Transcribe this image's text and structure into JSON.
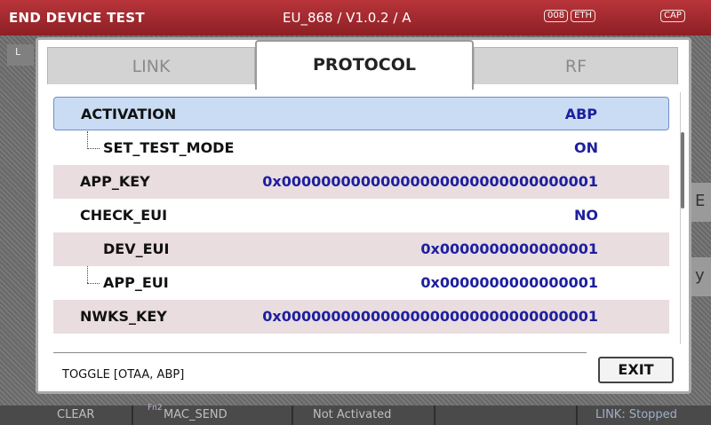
{
  "header": {
    "title": "END DEVICE TEST",
    "version": "EU_868 / V1.0.2 / A",
    "badges": [
      "008",
      "ETH"
    ],
    "badge_right": "CAP"
  },
  "side": {
    "left_tab": "L",
    "right_1": "E",
    "right_2": "y"
  },
  "dialog": {
    "tabs": [
      {
        "label": "LINK",
        "active": false
      },
      {
        "label": "PROTOCOL",
        "active": true
      },
      {
        "label": "RF",
        "active": false
      }
    ],
    "rows": [
      {
        "label": "ACTIVATION",
        "value": "ABP",
        "selected": true
      },
      {
        "label": "SET_TEST_MODE",
        "value": "ON"
      },
      {
        "label": "APP_KEY",
        "value": "0x00000000000000000000000000000001"
      },
      {
        "label": "CHECK_EUI",
        "value": "NO"
      },
      {
        "label": "DEV_EUI",
        "value": "0x0000000000000001"
      },
      {
        "label": "APP_EUI",
        "value": "0x0000000000000001"
      },
      {
        "label": "NWKS_KEY",
        "value": "0x00000000000000000000000000000001"
      }
    ],
    "hint": "TOGGLE [OTAA, ABP]",
    "exit_label": "EXIT"
  },
  "statusbar": {
    "clear": "CLEAR",
    "fn2": "Fn2",
    "mac_send": "MAC_SEND",
    "activation_state": "Not Activated",
    "link_state": "LINK: Stopped"
  },
  "colors": {
    "header_bg": "#9e2a30",
    "selected_row": "#c9dcf4",
    "alt_row": "#e9dde0",
    "value_text": "#1d1f9e"
  }
}
